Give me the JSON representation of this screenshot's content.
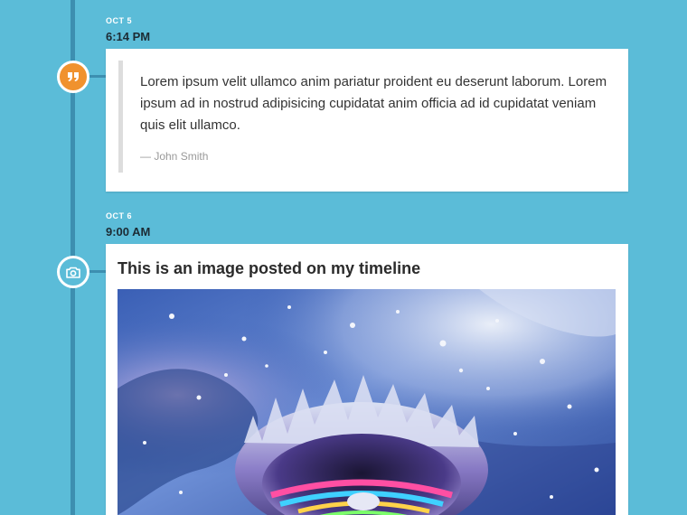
{
  "timeline": {
    "entries": [
      {
        "date": "OCT 5",
        "time": "6:14 PM",
        "icon": "quote-icon",
        "type": "quote",
        "quote": "Lorem ipsum velit ullamco anim pariatur proident eu deserunt laborum. Lorem ipsum ad in nostrud adipisicing cupidatat anim officia ad id cupidatat veniam quis elit ullamco.",
        "author": "— John Smith"
      },
      {
        "date": "OCT 6",
        "time": "9:00 AM",
        "icon": "camera-icon",
        "type": "image",
        "title": "This is an image posted on my timeline"
      }
    ]
  },
  "colors": {
    "background": "#5bbcd8",
    "timeline_line": "#3d8fb0",
    "quote_marker": "#f0922e",
    "camera_marker": "#5bbcd8"
  }
}
